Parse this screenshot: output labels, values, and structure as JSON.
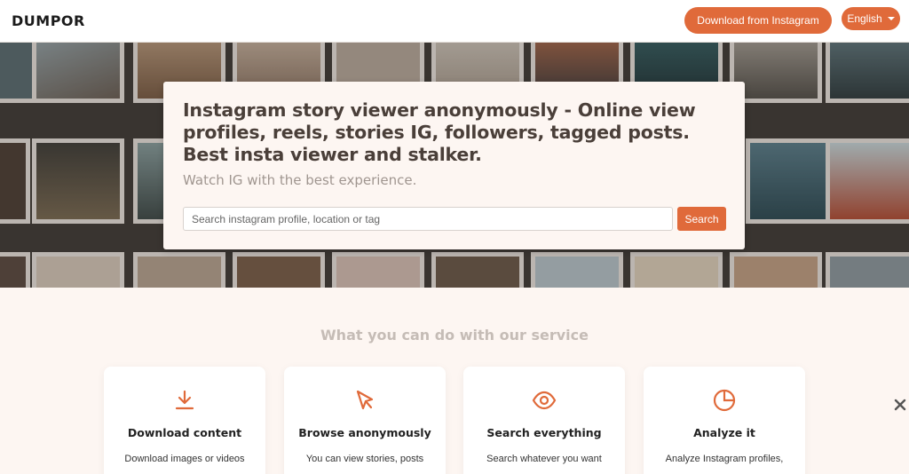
{
  "header": {
    "logo": "DUMPOR",
    "download_button": "Download from Instagram",
    "language_button": "English"
  },
  "hero": {
    "title": "Instagram story viewer anonymously - Online view profiles, reels, stories IG, followers, tagged posts. Best insta viewer and stalker.",
    "subtitle": "Watch IG with the best experience.",
    "search": {
      "placeholder": "Search instagram profile, location or tag",
      "button": "Search"
    }
  },
  "services": {
    "title": "What you can do with our service",
    "cards": [
      {
        "icon": "download-icon",
        "title": "Download content",
        "text": "Download images or videos"
      },
      {
        "icon": "cursor-icon",
        "title": "Browse anonymously",
        "text": "You can view stories, posts"
      },
      {
        "icon": "eye-icon",
        "title": "Search everything",
        "text": "Search whatever you want"
      },
      {
        "icon": "chart-icon",
        "title": "Analyze it",
        "text": "Analyze Instagram profiles,"
      }
    ]
  },
  "colors": {
    "accent": "#e06a3a",
    "page_background": "#fdf6f2",
    "heading": "#4a3f39"
  }
}
